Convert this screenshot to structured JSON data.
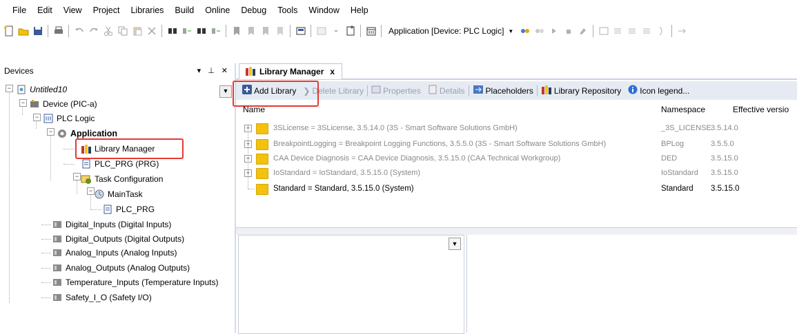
{
  "menu": [
    "File",
    "Edit",
    "View",
    "Project",
    "Libraries",
    "Build",
    "Online",
    "Debug",
    "Tools",
    "Window",
    "Help"
  ],
  "toolbar": {
    "application_combo": "Application [Device: PLC Logic]"
  },
  "devices": {
    "title": "Devices",
    "pin_glyph": "▾",
    "dock_glyph": "⊥",
    "close_glyph": "✕",
    "tree": [
      {
        "label": "Untitled10"
      },
      {
        "label": "Device (PIC-a)"
      },
      {
        "label": "PLC Logic"
      },
      {
        "label": "Application"
      },
      {
        "label": "Library Manager"
      },
      {
        "label": "PLC_PRG (PRG)"
      },
      {
        "label": "Task Configuration"
      },
      {
        "label": "MainTask"
      },
      {
        "label": "PLC_PRG"
      },
      {
        "label": "Digital_Inputs (Digital Inputs)"
      },
      {
        "label": "Digital_Outputs (Digital Outputs)"
      },
      {
        "label": "Analog_Inputs (Analog Inputs)"
      },
      {
        "label": "Analog_Outputs (Analog Outputs)"
      },
      {
        "label": "Temperature_Inputs (Temperature Inputs)"
      },
      {
        "label": "Safety_I_O (Safety I/O)"
      }
    ]
  },
  "library_manager": {
    "tab_label": "Library Manager",
    "tab_close": "x",
    "toolbar": {
      "add_library": "Add Library",
      "delete_library": "Delete Library",
      "properties": "Properties",
      "details": "Details",
      "placeholders": "Placeholders",
      "library_repository": "Library Repository",
      "icon_legend": "Icon legend..."
    },
    "columns": {
      "name": "Name",
      "namespace": "Namespace",
      "effective_version": "Effective versio"
    },
    "rows": [
      {
        "name": "3SLicense = 3SLicense, 3.5.14.0 (3S - Smart Software Solutions GmbH)",
        "namespace": "_3S_LICENSE",
        "version": "3.5.14.0"
      },
      {
        "name": "BreakpointLogging = Breakpoint Logging Functions, 3.5.5.0 (3S - Smart Software Solutions GmbH)",
        "namespace": "BPLog",
        "version": "3.5.5.0"
      },
      {
        "name": "CAA Device Diagnosis = CAA Device Diagnosis, 3.5.15.0 (CAA Technical Workgroup)",
        "namespace": "DED",
        "version": "3.5.15.0"
      },
      {
        "name": "IoStandard = IoStandard, 3.5.15.0 (System)",
        "namespace": "IoStandard",
        "version": "3.5.15.0"
      },
      {
        "name": "Standard = Standard, 3.5.15.0 (System)",
        "namespace": "Standard",
        "version": "3.5.15.0"
      }
    ]
  },
  "colors": {
    "highlight": "#e53935",
    "toolbar_bg": "#e6ebf3",
    "folder": "#f4c20d"
  }
}
